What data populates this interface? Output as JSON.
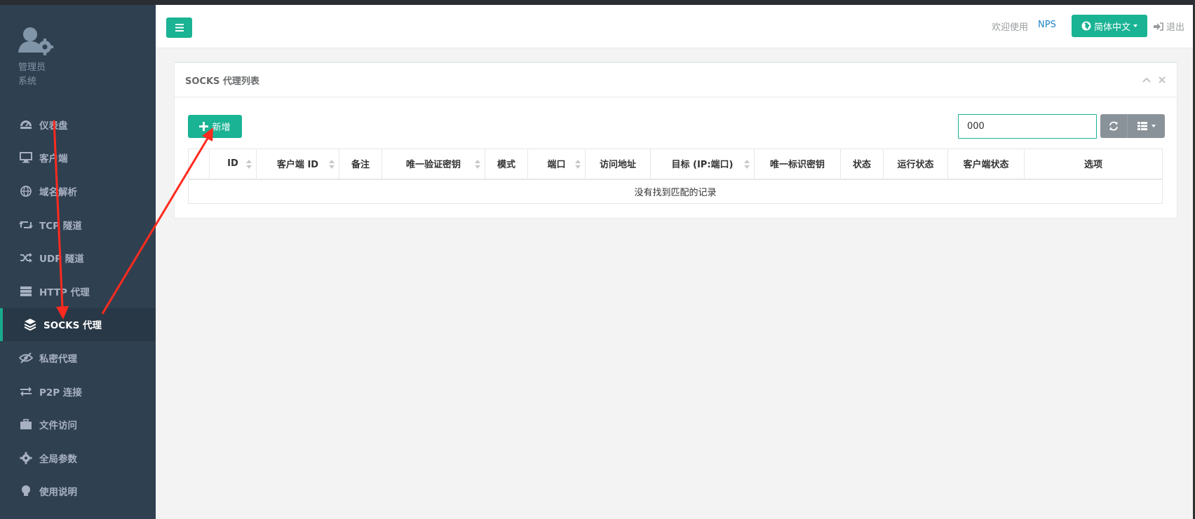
{
  "profile": {
    "role": "管理员",
    "sub": "系统"
  },
  "sidebar": {
    "items": [
      {
        "label": "仪表盘",
        "icon": "dashboard-icon",
        "active": false
      },
      {
        "label": "客户端",
        "icon": "monitor-icon",
        "active": false
      },
      {
        "label": "域名解析",
        "icon": "globe-icon",
        "active": false
      },
      {
        "label": "TCP 隧道",
        "icon": "retweet-icon",
        "active": false
      },
      {
        "label": "UDP 隧道",
        "icon": "random-icon",
        "active": false
      },
      {
        "label": "HTTP 代理",
        "icon": "server-icon",
        "active": false
      },
      {
        "label": "SOCKS 代理",
        "icon": "layers-icon",
        "active": true
      },
      {
        "label": "私密代理",
        "icon": "eye-slash-icon",
        "active": false
      },
      {
        "label": "P2P 连接",
        "icon": "exchange-icon",
        "active": false
      },
      {
        "label": "文件访问",
        "icon": "briefcase-icon",
        "active": false
      },
      {
        "label": "全局参数",
        "icon": "gear-icon",
        "active": false
      },
      {
        "label": "使用说明",
        "icon": "lightbulb-icon",
        "active": false
      }
    ]
  },
  "header": {
    "welcome": "欢迎使用",
    "nps": "NPS",
    "language": "简体中文",
    "logout": "退出"
  },
  "panel": {
    "title": "SOCKS 代理列表",
    "add_label": "新增",
    "search_value": "000",
    "columns": [
      {
        "label": "",
        "sortable": false
      },
      {
        "label": "ID",
        "sortable": true
      },
      {
        "label": "客户端 ID",
        "sortable": true
      },
      {
        "label": "备注",
        "sortable": false
      },
      {
        "label": "唯一验证密钥",
        "sortable": true
      },
      {
        "label": "模式",
        "sortable": false
      },
      {
        "label": "端口",
        "sortable": true
      },
      {
        "label": "访问地址",
        "sortable": false
      },
      {
        "label": "目标 (IP:端口)",
        "sortable": true
      },
      {
        "label": "唯一标识密钥",
        "sortable": false
      },
      {
        "label": "状态",
        "sortable": false
      },
      {
        "label": "运行状态",
        "sortable": false
      },
      {
        "label": "客户端状态",
        "sortable": false
      },
      {
        "label": "选项",
        "sortable": false
      }
    ],
    "empty_text": "没有找到匹配的记录"
  },
  "colors": {
    "accent": "#1ab394",
    "sidebar_bg": "#2f4050",
    "annotation_arrow": "#ff2a1f"
  }
}
